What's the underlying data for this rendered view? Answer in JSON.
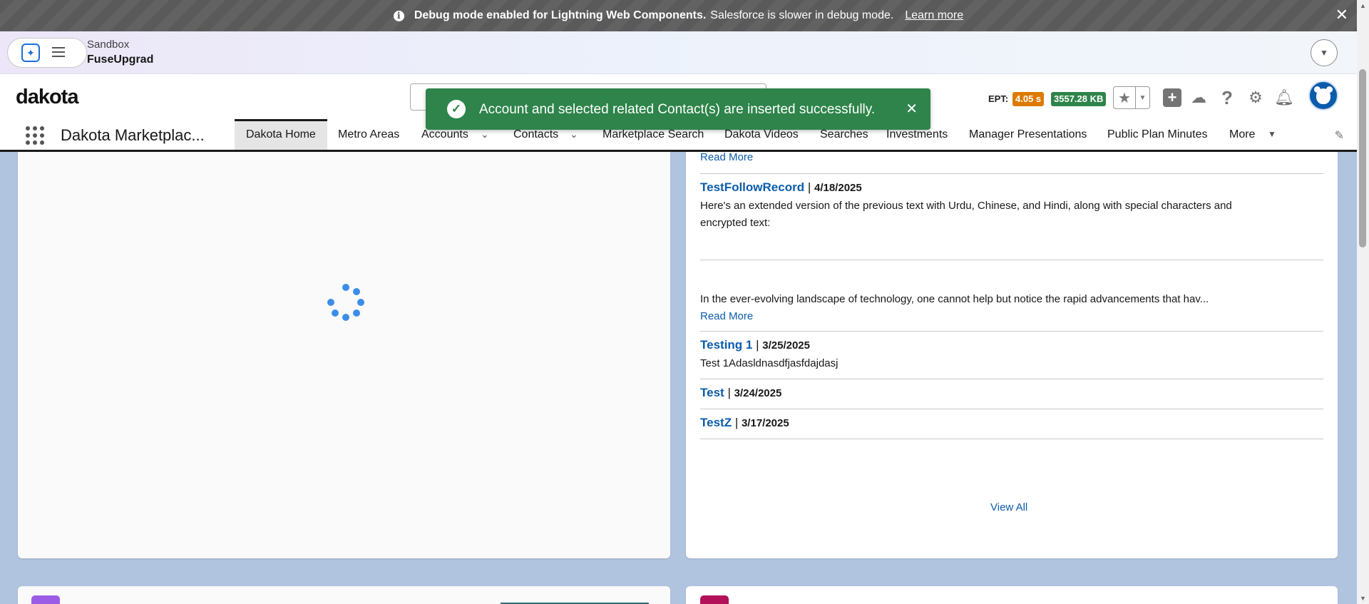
{
  "debug_banner": {
    "info_icon": "info-icon",
    "bold": "Debug mode enabled for Lightning Web Components.",
    "text": "Salesforce is slower in debug mode.",
    "link": "Learn more",
    "close": "✕"
  },
  "sandbox": {
    "label": "Sandbox",
    "name": "FuseUpgrad"
  },
  "header": {
    "logo": "dakota",
    "ept_label": "EPT:",
    "ept_time": "4.05 s",
    "ept_size": "3557.28 KB",
    "colors": {
      "ept_time": "#dd7a01",
      "ept_size": "#2e844a"
    }
  },
  "nav": {
    "app_name": "Dakota Marketplac...",
    "items": [
      {
        "label": "Dakota Home"
      },
      {
        "label": "Metro Areas"
      },
      {
        "label": "Accounts"
      },
      {
        "label": "Contacts"
      },
      {
        "label": "Marketplace Search"
      },
      {
        "label": "Dakota Videos"
      },
      {
        "label": "Searches"
      },
      {
        "label": "Investments"
      },
      {
        "label": "Manager Presentations"
      },
      {
        "label": "Public Plan Minutes"
      },
      {
        "label": "More"
      }
    ]
  },
  "toast": {
    "message": "Account and selected related Contact(s) are inserted successfully.",
    "accent": "#2e844a"
  },
  "feed": {
    "read_more_top": "Read More",
    "entries": [
      {
        "title": "TestFollowRecord",
        "date": "4/18/2025",
        "text1": "Here's an extended version of the previous text with Urdu, Chinese, and Hindi, along with special characters and",
        "text2": "encrypted text:",
        "text3": "In the ever-evolving landscape of technology, one cannot help but notice the rapid advancements that hav...",
        "read_more": "Read More"
      },
      {
        "title": "Testing 1",
        "date": "3/25/2025",
        "text1": "Test 1Adasldnasdfjasfdajdasj"
      },
      {
        "title": "Test",
        "date": "3/24/2025"
      },
      {
        "title": "TestZ",
        "date": "3/17/2025"
      }
    ],
    "view_all": "View All",
    "separator": "|"
  }
}
